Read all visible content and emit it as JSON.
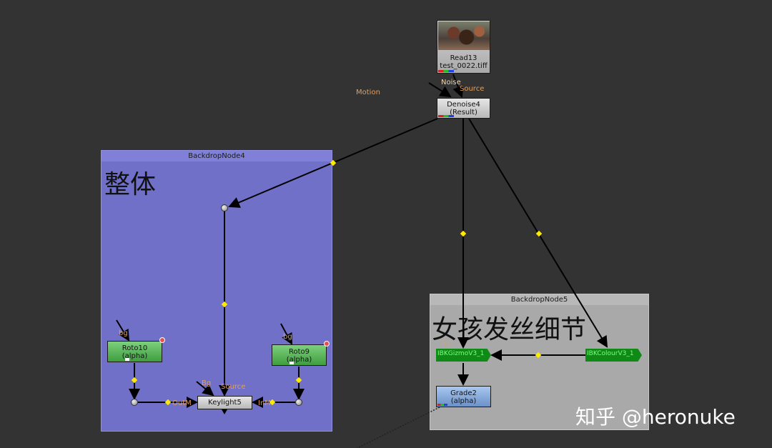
{
  "nodes": {
    "read13": {
      "name": "Read13",
      "file": "test_0022.tiff"
    },
    "denoise4": {
      "name": "Denoise4",
      "sub": "(Result)"
    },
    "roto10": {
      "name": "Roto10",
      "sub": "(alpha)"
    },
    "roto9": {
      "name": "Roto9",
      "sub": "(alpha)"
    },
    "keylight5": {
      "name": "Keylight5"
    },
    "ibk_gizmo": {
      "name": "IBKGizmoV3_1"
    },
    "ibk_colour": {
      "name": "IBKColourV3_1"
    },
    "grade2": {
      "name": "Grade2",
      "sub": "(alpha)"
    }
  },
  "backdrops": {
    "bd4": {
      "title": "BackdropNode4",
      "label": "整体",
      "color": "#7070c8"
    },
    "bd5": {
      "title": "BackdropNode5",
      "label": "女孩发丝细节",
      "color": "#a9a9a9"
    }
  },
  "inputs": {
    "motion": "Motion",
    "noise": "Noise",
    "source": "Source",
    "bg": "bg",
    "bg_cap": "Bg",
    "outm": "OutM",
    "inm": "InM"
  },
  "colors": {
    "background": "#333333",
    "pipe": "#000000",
    "pin": "#ffea00",
    "input_label": "#e0a060"
  },
  "watermark": "知乎 @heronuke"
}
